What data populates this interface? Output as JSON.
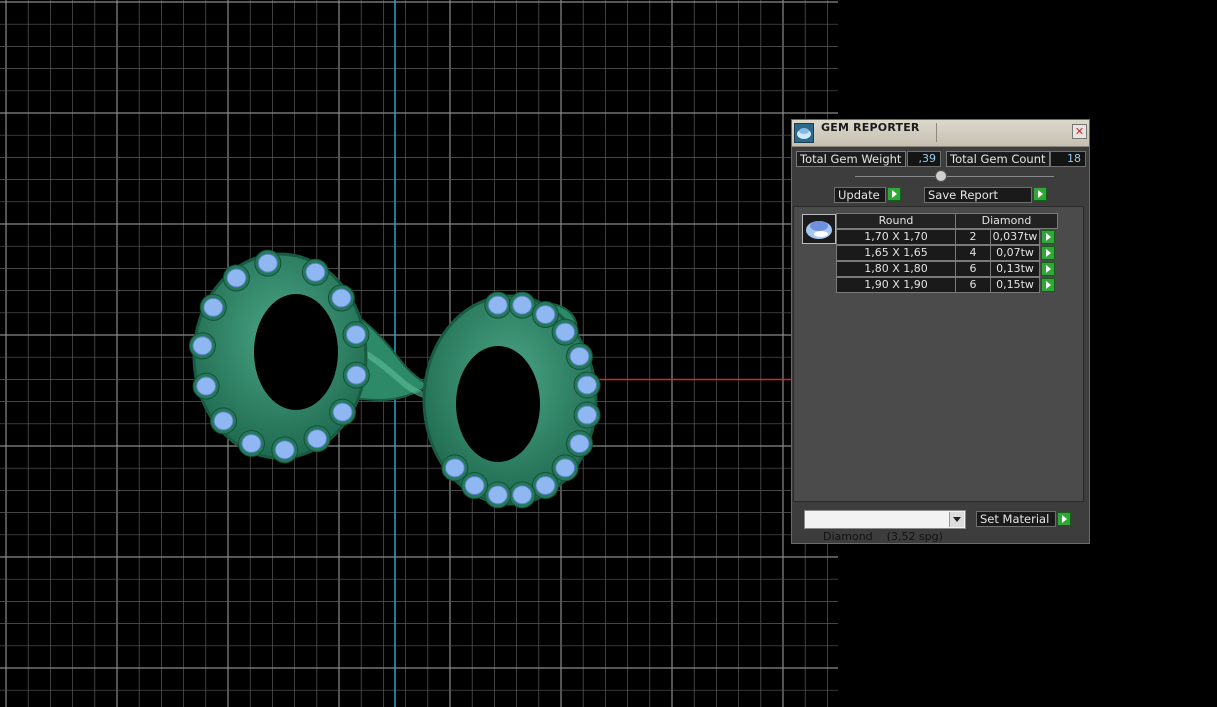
{
  "viewport": {
    "name": "3D model viewport",
    "colors": {
      "background": "#000000",
      "grid": "#5a5a5a",
      "axis_y": "#2aa4c8",
      "axis_x": "#d22828",
      "metal": "#2e8a6a",
      "gems": "#8fb7f2"
    }
  },
  "gem_reporter": {
    "title": "GEM REPORTER",
    "total_gem_weight_label": "Total Gem Weight",
    "total_gem_weight_value": ",39",
    "total_gem_count_label": "Total Gem Count",
    "total_gem_count_value": "18",
    "update_label": "Update",
    "save_report_label": "Save Report",
    "table": {
      "headers": [
        "Round",
        "Diamond"
      ],
      "rows": [
        {
          "size": "1,70 X 1,70",
          "count": "2",
          "weight": "0,037tw"
        },
        {
          "size": "1,65 X 1,65",
          "count": "4",
          "weight": "0,07tw"
        },
        {
          "size": "1,80 X 1,80",
          "count": "6",
          "weight": "0,13tw"
        },
        {
          "size": "1,90 X 1,90",
          "count": "6",
          "weight": "0,15tw"
        }
      ]
    },
    "material_select_value": "Diamond    (3,52 spg)",
    "set_material_label": "Set Material",
    "icons": {
      "title": "gem-reporter-icon",
      "close": "close-icon",
      "gem": "round-gem-icon"
    }
  }
}
